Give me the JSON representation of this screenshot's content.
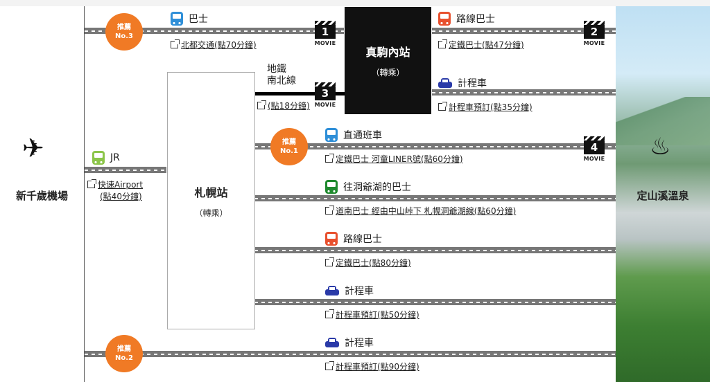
{
  "places": {
    "origin": "新千歲機場",
    "destination": "定山溪溫泉",
    "sapporo": {
      "name": "札幌站",
      "transfer": "（轉乘）"
    },
    "makomanai": {
      "name": "真駒內站",
      "transfer": "（轉乘）"
    }
  },
  "badges": [
    {
      "top": "推薦",
      "bottom": "No.3"
    },
    {
      "top": "推薦",
      "bottom": "No.1"
    },
    {
      "top": "推薦",
      "bottom": "No.2"
    }
  ],
  "movies": [
    {
      "num": "1",
      "label": "MOVIE"
    },
    {
      "num": "2",
      "label": "MOVIE"
    },
    {
      "num": "3",
      "label": "MOVIE"
    },
    {
      "num": "4",
      "label": "MOVIE"
    }
  ],
  "routes": {
    "bus_top": {
      "label": "巴士",
      "link": "北都交通(點70分鐘)",
      "icon": "bus-icon",
      "color": "#2f8fd8"
    },
    "jr": {
      "label": "JR",
      "link1": "快速Airport",
      "link2": "(點40分鐘)",
      "icon": "train-icon",
      "color": "#8cc54a"
    },
    "subway": {
      "label1": "地鐵",
      "label2": "南北線",
      "link": "(點18分鐘)"
    },
    "route_bus_right": {
      "label": "路線巴士",
      "link": "定鐵巴士(點47分鐘)",
      "icon": "bus-icon",
      "color": "#e8502e"
    },
    "taxi_right": {
      "label": "計程車",
      "link": "計程車預訂(點35分鐘)",
      "icon": "taxi-icon",
      "color": "#2a3aa8"
    },
    "direct": {
      "label": "直通班車",
      "link": "定鐵巴士 河童LINER號(點60分鐘)",
      "icon": "bus-icon",
      "color": "#2f8fd8"
    },
    "toya": {
      "label": "往洞爺湖的巴士",
      "link": "道南巴士 經由中山峠下 札幌洞爺湖線(點60分鐘)",
      "icon": "bus-icon",
      "color": "#1f8a2e"
    },
    "route_bus": {
      "label": "路線巴士",
      "link": "定鐵巴士(點80分鐘)",
      "icon": "bus-icon",
      "color": "#e8502e"
    },
    "taxi_mid": {
      "label": "計程車",
      "link": "計程車預訂(點50分鐘)",
      "icon": "taxi-icon",
      "color": "#2a3aa8"
    },
    "taxi_bottom": {
      "label": "計程車",
      "link": "計程車預訂(點90分鐘)",
      "icon": "taxi-icon",
      "color": "#2a3aa8"
    }
  }
}
